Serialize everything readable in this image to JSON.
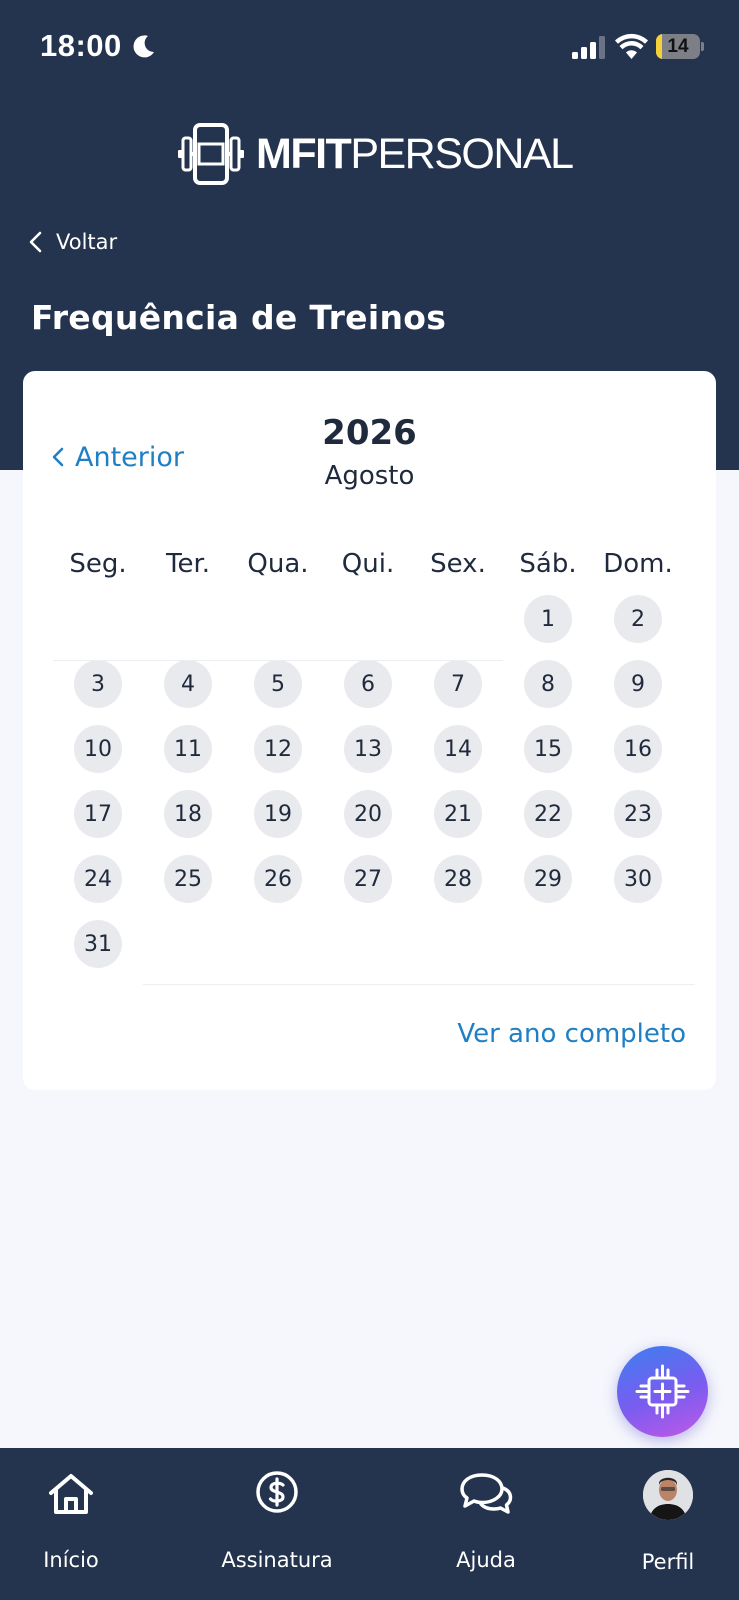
{
  "status_bar": {
    "time": "18:00",
    "battery": "14",
    "battery_level": 0.14
  },
  "header": {
    "logo_bold": "MFIT",
    "logo_light": "PERSONAL",
    "back_label": "Voltar",
    "title": "Frequência de Treinos"
  },
  "calendar": {
    "prev_label": "Anterior",
    "year": "2026",
    "month": "Agosto",
    "weekdays": [
      "Seg.",
      "Ter.",
      "Qua.",
      "Qui.",
      "Sex.",
      "Sáb.",
      "Dom."
    ],
    "first_weekday_index": 5,
    "days": [
      "1",
      "2",
      "3",
      "4",
      "5",
      "6",
      "7",
      "8",
      "9",
      "10",
      "11",
      "12",
      "13",
      "14",
      "15",
      "16",
      "17",
      "18",
      "19",
      "20",
      "21",
      "22",
      "23",
      "24",
      "25",
      "26",
      "27",
      "28",
      "29",
      "30",
      "31"
    ],
    "full_year_label": "Ver ano completo"
  },
  "bottom_nav": {
    "items": [
      {
        "label": "Início",
        "icon": "home-icon"
      },
      {
        "label": "Assinatura",
        "icon": "dollar-circle-icon"
      },
      {
        "label": "Ajuda",
        "icon": "chat-bubbles-icon"
      },
      {
        "label": "Perfil",
        "icon": "avatar"
      }
    ]
  },
  "fab": {
    "icon": "ai-chip-icon"
  },
  "colors": {
    "header_bg": "#24344e",
    "accent": "#1f7fc5",
    "day_bg": "#e9eaed",
    "page_bg": "#f5f7fc"
  }
}
